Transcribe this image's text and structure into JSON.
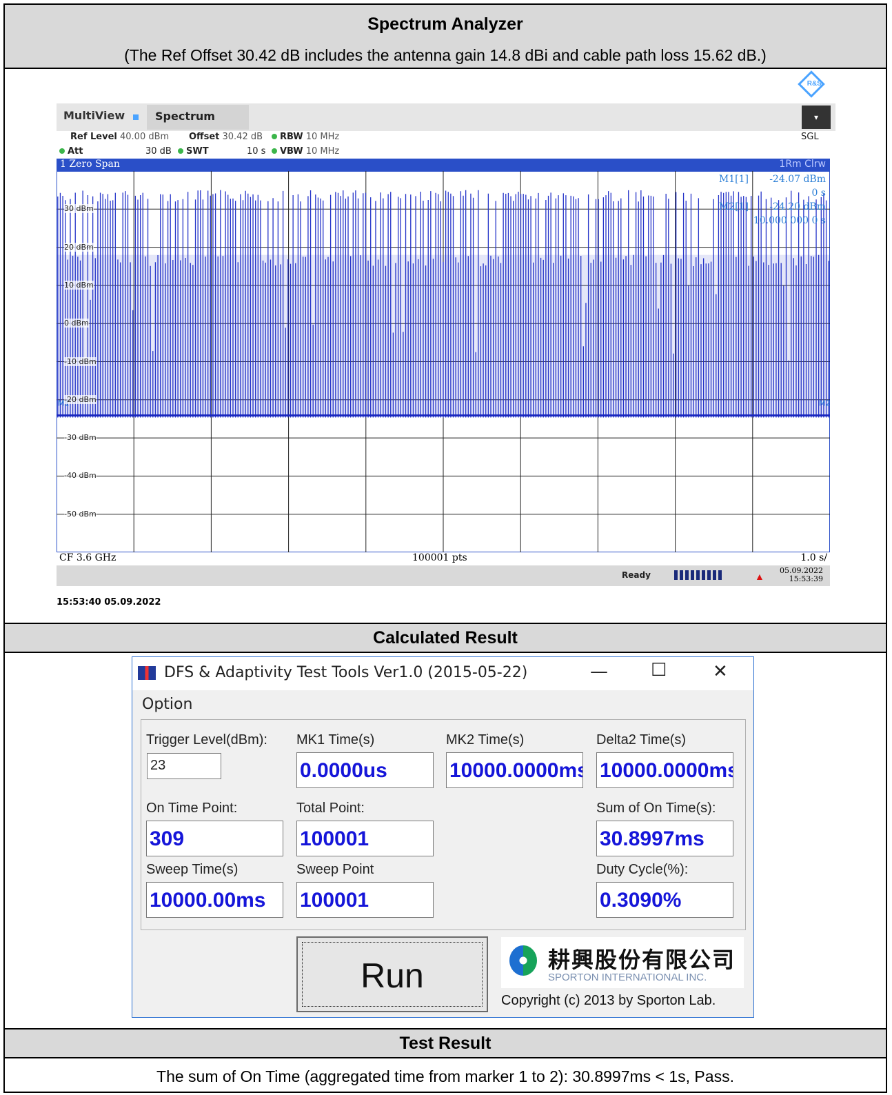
{
  "section_headers": {
    "spectrum_title": "Spectrum Analyzer",
    "spectrum_note": "(The Ref Offset 30.42 dB includes the antenna gain 14.8 dBi and cable path loss 15.62 dB.)",
    "calculated": "Calculated Result",
    "test_result": "Test Result"
  },
  "analyzer": {
    "tab1": "MultiView",
    "tab2": "Spectrum",
    "mode": "SGL",
    "ref_level_label": "Ref Level",
    "ref_level": "40.00 dBm",
    "offset_label": "Offset",
    "offset": "30.42 dB",
    "rbw_label": "RBW",
    "rbw": "10 MHz",
    "att_label": "Att",
    "att": "30 dB",
    "swt_label": "SWT",
    "swt": "10 s",
    "vbw_label": "VBW",
    "vbw": "10 MHz",
    "window_title": "1 Zero Span",
    "trace_label": "1Rm Clrw",
    "marker1": {
      "name": "M1[1]",
      "value": "-24.07 dBm",
      "time": "0 s"
    },
    "marker2": {
      "name": "M2[1]",
      "value": "-24.20 dBm",
      "time": "10.000 000 0 s"
    },
    "y_labels": [
      "30 dBm",
      "20 dBm",
      "10 dBm",
      "0 dBm",
      "-10 dBm",
      "-20 dBm",
      "-30 dBm",
      "-40 dBm",
      "-50 dBm"
    ],
    "cf": "CF 3.6 GHz",
    "pts": "100001 pts",
    "span": "1.0 s/",
    "status": "Ready",
    "date": "05.09.2022",
    "time": "15:53:39",
    "timestamp": "15:53:40  05.09.2022",
    "m1_tag": "M1",
    "m2_tag": "M2"
  },
  "chart_data": {
    "type": "line",
    "title": "1 Zero Span",
    "xlabel": "",
    "ylabel": "",
    "ylim": [
      -60,
      40
    ],
    "xlim": [
      0,
      10
    ],
    "y_ticks": [
      30,
      20,
      10,
      0,
      -10,
      -20,
      -30,
      -40,
      -50
    ],
    "noise_floor_dbm": -24.1,
    "pulse_peak_dbm": 35,
    "pulse_body_dbm": 18,
    "pulse_count": 309,
    "grid": true
  },
  "dialog": {
    "title": "DFS & Adaptivity Test Tools Ver1.0 (2015-05-22)",
    "menu": "Option",
    "trigger_label": "Trigger Level(dBm):",
    "trigger_value": "23",
    "mk1_label": "MK1 Time(s)",
    "mk1_value": "0.0000us",
    "mk2_label": "MK2 Time(s)",
    "mk2_value": "10000.0000ms",
    "delta_label": "Delta2 Time(s)",
    "delta_value": "10000.0000ms",
    "ontime_label": "On Time Point:",
    "ontime_value": "309",
    "total_label": "Total Point:",
    "total_value": "100001",
    "sum_label": "Sum of On Time(s):",
    "sum_value": "30.8997ms",
    "sweep_time_label": "Sweep Time(s)",
    "sweep_time_value": "10000.00ms",
    "sweep_point_label": "Sweep Point",
    "sweep_point_value": "100001",
    "duty_label": "Duty Cycle(%):",
    "duty_value": "0.3090%",
    "run_label": "Run",
    "company_cn": "耕興股份有限公司",
    "company_en": "SPORTON INTERNATIONAL INC.",
    "copyright": "Copyright (c) 2013 by Sporton Lab."
  },
  "result_text": "The sum of On Time (aggregated time from marker 1 to 2): 30.8997ms < 1s, Pass."
}
